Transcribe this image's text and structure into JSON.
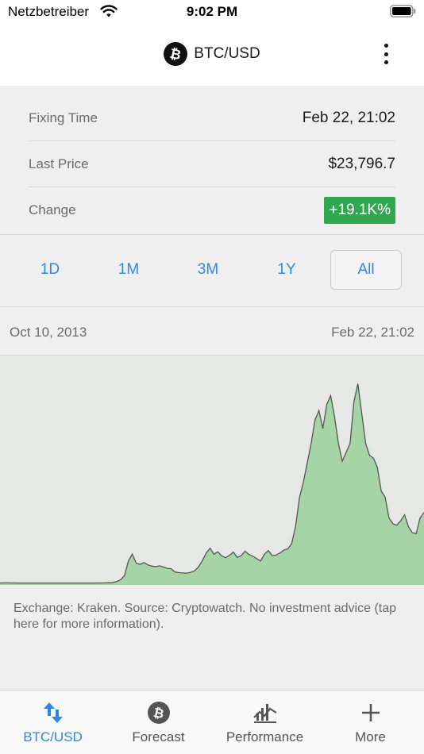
{
  "status_bar": {
    "carrier": "Netzbetreiber",
    "time": "9:02 PM"
  },
  "nav": {
    "title": "BTC/USD",
    "logo_icon": "bitcoin-icon",
    "menu_icon": "more-vertical-icon"
  },
  "info": {
    "rows": [
      {
        "label": "Fixing Time",
        "value": "Feb 22, 21:02"
      },
      {
        "label": "Last Price",
        "value": "$23,796.7"
      },
      {
        "label": "Change",
        "value": "+19.1K%"
      }
    ],
    "change_color": "#2fa84f"
  },
  "ranges": {
    "options": [
      "1D",
      "1M",
      "3M",
      "1Y",
      "All"
    ],
    "selected": "All",
    "accent": "#2f88e0"
  },
  "chart": {
    "start_label": "Oct 10, 2013",
    "end_label": "Feb 22, 21:02"
  },
  "chart_data": {
    "type": "area",
    "x_start": "Oct 10, 2013",
    "x_end": "Feb 22, 21:02",
    "fill_color": "#a6d4a6",
    "line_color": "#555555",
    "values": [
      140,
      160,
      150,
      130,
      120,
      115,
      110,
      105,
      100,
      98,
      96,
      95,
      94,
      95,
      96,
      97,
      98,
      99,
      100,
      102,
      104,
      106,
      108,
      110,
      115,
      120,
      130,
      150,
      200,
      300,
      600,
      1200,
      2600,
      7500,
      9800,
      6800,
      6400,
      7000,
      6200,
      5800,
      5600,
      5900,
      5500,
      5000,
      4900,
      3800,
      3600,
      3500,
      3400,
      3700,
      4200,
      5500,
      7600,
      10200,
      11800,
      9800,
      10600,
      9200,
      8600,
      9400,
      10500,
      8700,
      9300,
      10800,
      9700,
      9100,
      8300,
      7500,
      9800,
      11000,
      9300,
      9500,
      10200,
      11200,
      11600,
      13400,
      19200,
      28800,
      34000,
      40500,
      47000,
      55000,
      58000,
      52000,
      60000,
      63000,
      56000,
      47000,
      41000,
      44000,
      47000,
      61000,
      67000,
      57000,
      47000,
      43000,
      42000,
      39000,
      31000,
      29000,
      22000,
      20000,
      19500,
      21000,
      23000,
      19000,
      17000,
      16700,
      22000,
      23800
    ],
    "ylim": [
      0,
      69000
    ]
  },
  "disclaimer": "Exchange: Kraken. Source: Cryptowatch. No investment advice (tap here for more information).",
  "tabs": [
    {
      "label": "BTC/USD",
      "icon": "swap-arrows-icon",
      "active": true
    },
    {
      "label": "Forecast",
      "icon": "bitcoin-icon",
      "active": false
    },
    {
      "label": "Performance",
      "icon": "performance-chart-icon",
      "active": false
    },
    {
      "label": "More",
      "icon": "plus-icon",
      "active": false
    }
  ]
}
